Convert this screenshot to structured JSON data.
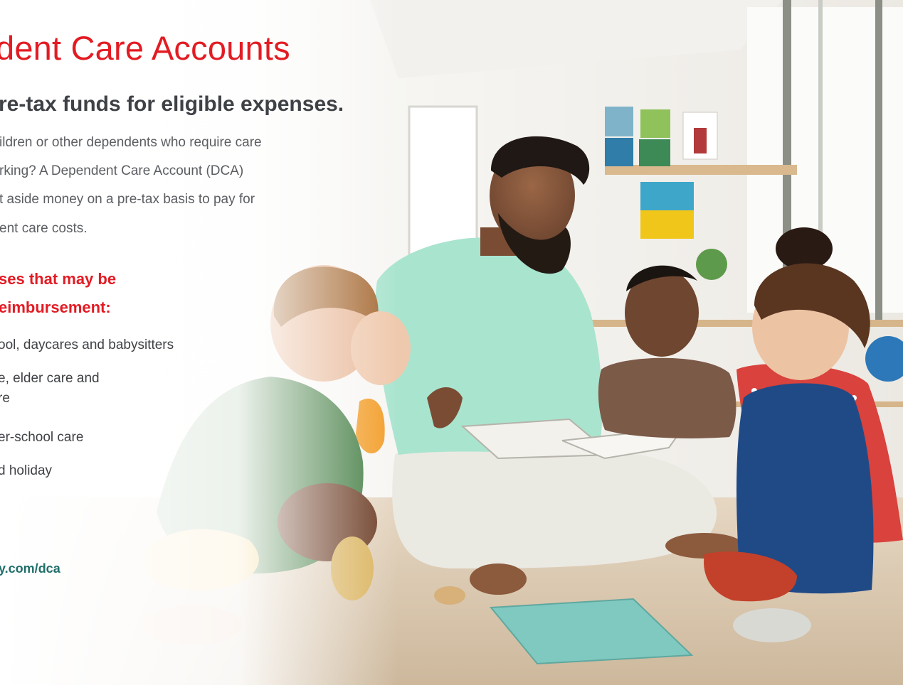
{
  "heading": {
    "title": "dent Care Accounts",
    "subtitle": "re-tax funds for eligible expenses."
  },
  "intro_lines": [
    "ildren or other dependents who require care",
    "rking? A Dependent Care Account (DCA)",
    "t aside money on a pre-tax basis to pay for",
    "ent care costs."
  ],
  "eligible_heading": [
    "ses that may be",
    "eimbursement:"
  ],
  "expense_lines": [
    "ool, daycares and babysitters",
    "e, elder care and",
    "re",
    "er-school care",
    "d holiday"
  ],
  "url": "y.com/dca",
  "colors": {
    "accent_red": "#e31b23",
    "heading_gray": "#3e4145",
    "body_gray": "#5b5e62",
    "url_teal": "#1f6f6a"
  },
  "photo": {
    "subject": "man reading a book to four children sitting on the floor"
  }
}
